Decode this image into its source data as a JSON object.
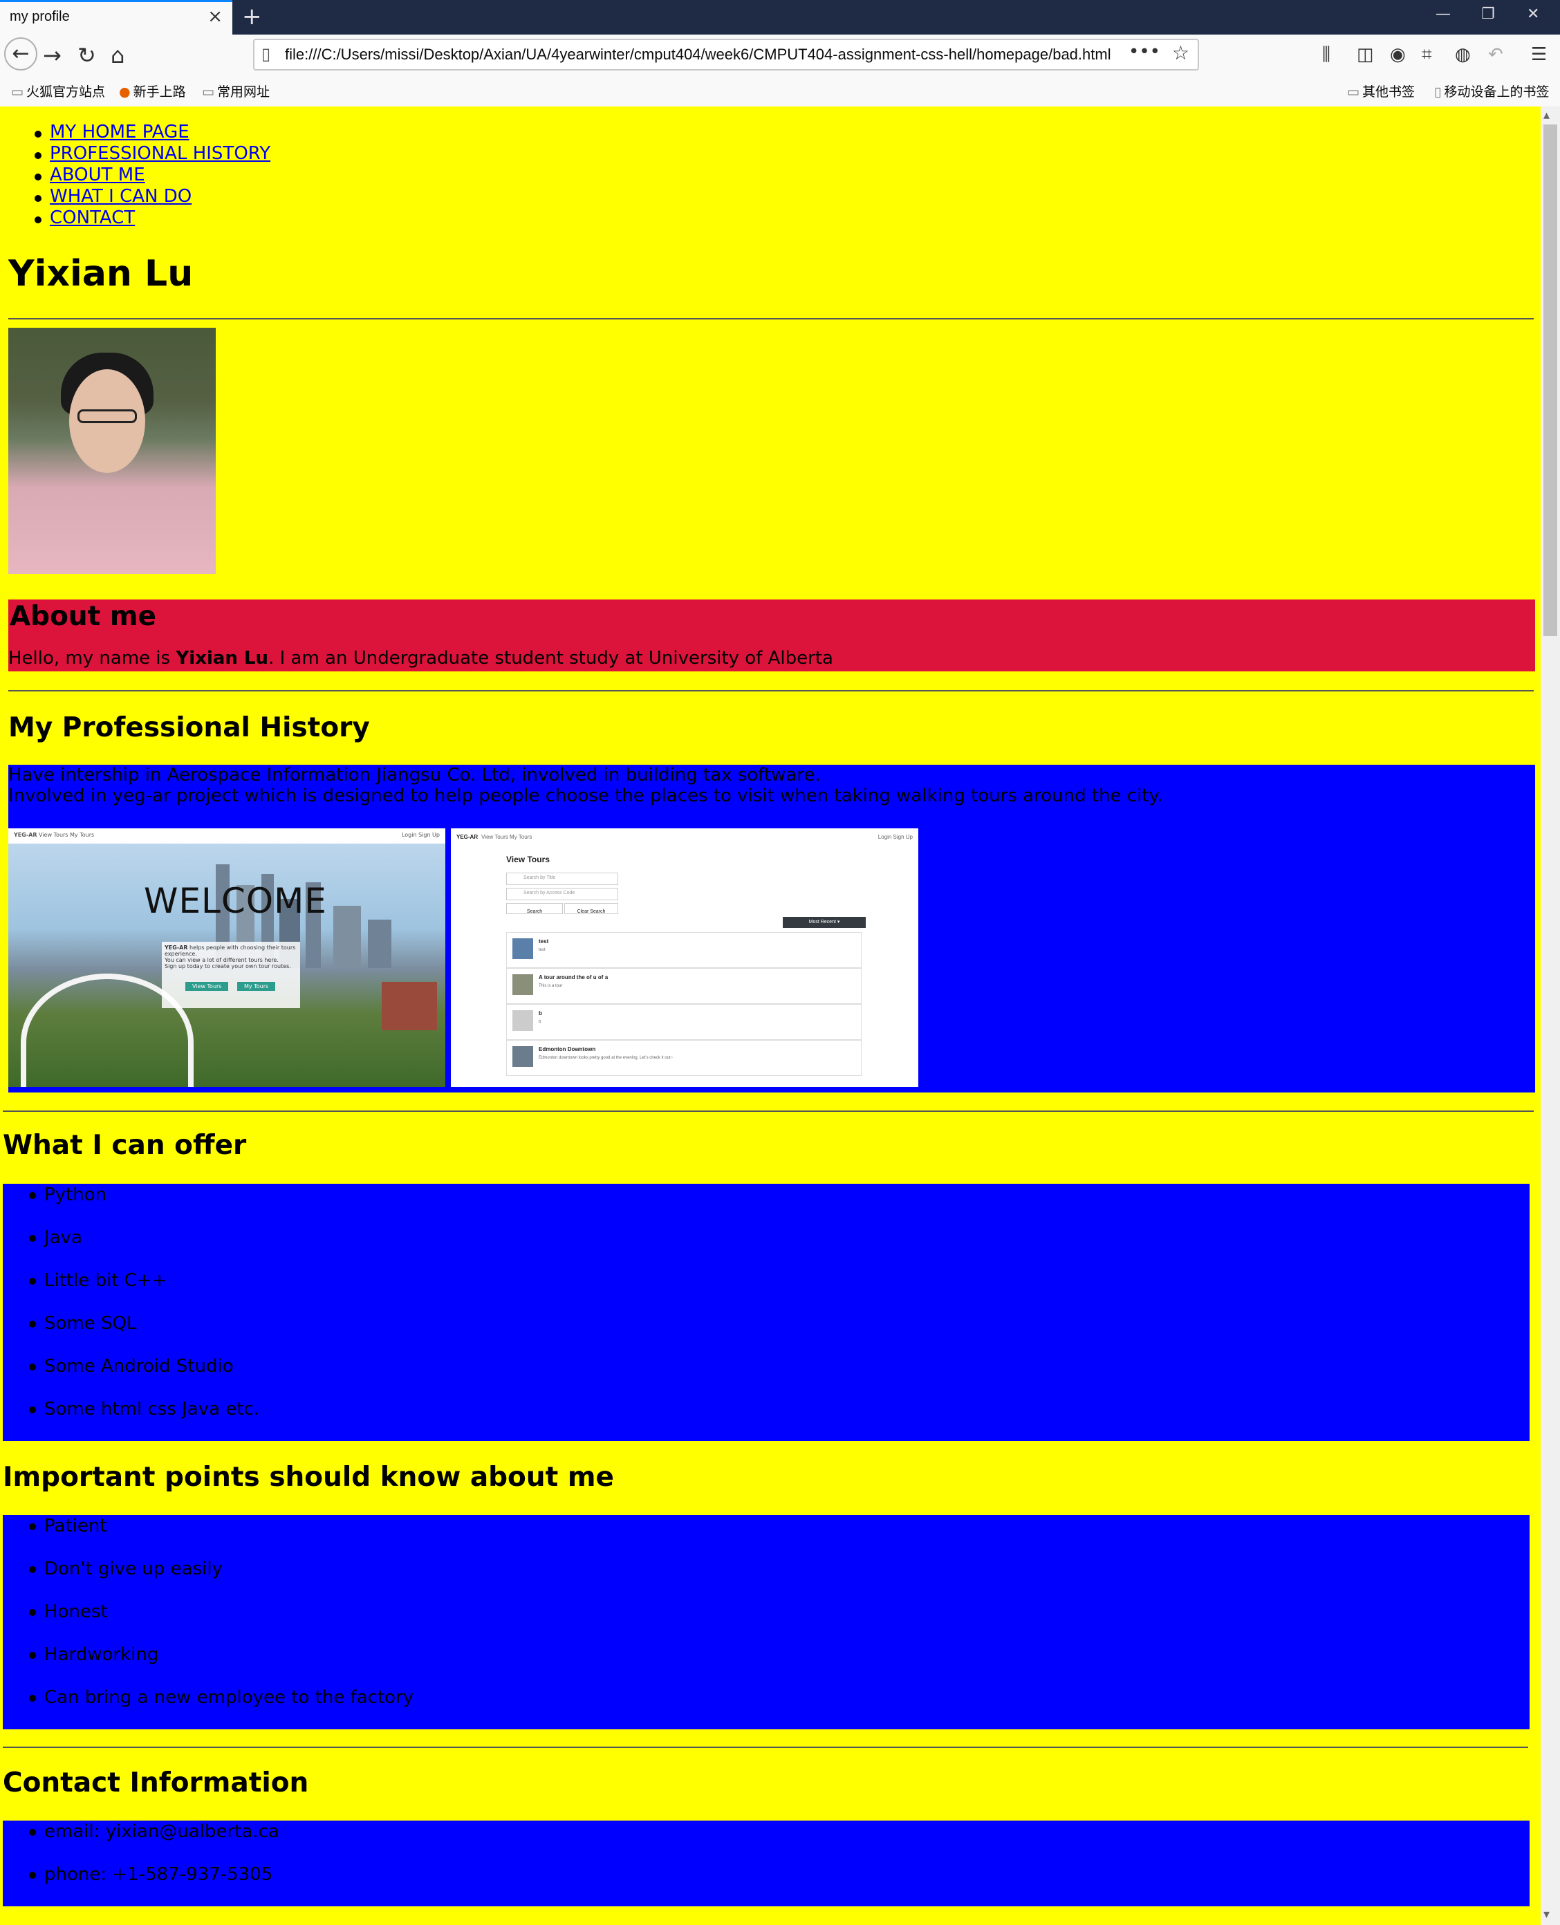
{
  "browser": {
    "tab_title": "my profile",
    "url": "file:///C:/Users/missi/Desktop/Axian/UA/4yearwinter/cmput404/week6/CMPUT404-assignment-css-hell/homepage/bad.html",
    "bookmarks_left": [
      {
        "label": "火狐官方站点",
        "icon": "folder-icon"
      },
      {
        "label": "新手上路",
        "icon": "firefox-icon"
      },
      {
        "label": "常用网址",
        "icon": "folder-icon"
      }
    ],
    "bookmarks_right": [
      {
        "label": "其他书签",
        "icon": "folder-icon"
      },
      {
        "label": "移动设备上的书签",
        "icon": "mobile-icon"
      }
    ]
  },
  "site_nav": [
    {
      "label": "MY HOME PAGE"
    },
    {
      "label": "PROFESSIONAL HISTORY"
    },
    {
      "label": "ABOUT ME"
    },
    {
      "label": "WHAT I CAN DO"
    },
    {
      "label": "CONTACT"
    }
  ],
  "header": {
    "name": "Yixian Lu"
  },
  "about": {
    "title": "About me",
    "text_before": "Hello, my name is ",
    "text_bold": "Yixian Lu",
    "text_after": ". I am an Undergraduate student study at University of Alberta"
  },
  "history": {
    "title": "My Professional History",
    "line1": "Have intership in Aerospace Information Jiangsu Co. Ltd, involved in building tax software.",
    "line2": "Involved in yeg-ar project which is designed to help people choose the places to visit when taking walking tours around the city.",
    "screenshot1": {
      "brand": "YEG-AR",
      "nav": "View Tours  My Tours",
      "auth": "Login  Sign Up",
      "welcome": "WELCOME",
      "card_title": "YEG-AR",
      "card_text": "helps people with choosing their tours experience.",
      "card_text2": "You can view a lot of different tours here.",
      "card_text3": "Sign up today to create your own tour routes.",
      "btn1": "View Tours",
      "btn2": "My Tours"
    },
    "screenshot2": {
      "brand": "YEG-AR",
      "nav": "View Tours  My Tours",
      "auth": "Login  Sign Up",
      "heading": "View Tours",
      "search_title": "Search by Title",
      "search_code": "Search by Access Code",
      "search_btn": "Search",
      "clear_btn": "Clear Search",
      "sort_btn": "Most Recent ▾",
      "rows": [
        {
          "title": "test",
          "desc": "test"
        },
        {
          "title": "A tour around the of u of a",
          "desc": "This is a tour"
        },
        {
          "title": "b",
          "desc": "b"
        },
        {
          "title": "Edmonton Downtown",
          "desc": "Edmonton downtown looks pretty good at the evening. Let's check it out~"
        }
      ]
    }
  },
  "offer": {
    "title": "What I can offer",
    "items": [
      "Python",
      "Java",
      "Little bit C++",
      "Some SQL",
      "Some Android Studio",
      "Some html css Java etc."
    ]
  },
  "points": {
    "title": "Important points should know about me",
    "items": [
      "Patient",
      "Don't give up easily",
      "Honest",
      "Hardworking",
      "Can bring a new employee to the factory"
    ]
  },
  "contact": {
    "title": "Contact Information",
    "items": [
      "email: yixian@ualberta.ca",
      "phone: +1-587-937-5305"
    ]
  },
  "colors": {
    "page_bg": "#ffff00",
    "about_bg": "#dc143c",
    "section_bg": "#0000ff",
    "link": "#0000ee"
  }
}
